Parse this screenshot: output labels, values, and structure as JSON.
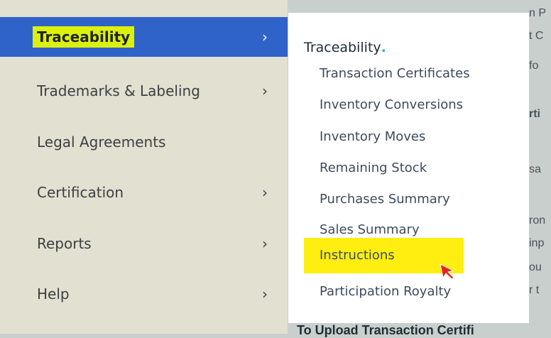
{
  "left_menu": {
    "items": [
      {
        "label": "Traceability",
        "has_submenu": true,
        "active": true
      },
      {
        "label": "Trademarks & Labeling",
        "has_submenu": true,
        "active": false
      },
      {
        "label": "Legal Agreements",
        "has_submenu": false,
        "active": false
      },
      {
        "label": "Certification",
        "has_submenu": true,
        "active": false
      },
      {
        "label": "Reports",
        "has_submenu": true,
        "active": false
      },
      {
        "label": "Help",
        "has_submenu": true,
        "active": false
      }
    ],
    "chevron": "›"
  },
  "submenu": {
    "title": "Traceability",
    "title_dot": ".",
    "items": [
      {
        "label": "Transaction Certificates"
      },
      {
        "label": "Inventory Conversions"
      },
      {
        "label": "Inventory Moves"
      },
      {
        "label": "Remaining Stock"
      },
      {
        "label": "Purchases Summary"
      },
      {
        "label": "Sales Summary"
      },
      {
        "label": "Instructions",
        "highlighted": true
      },
      {
        "label": "Participation Royalty"
      }
    ]
  },
  "background": {
    "bottom_heading": "To Upload Transaction Certifi",
    "fragments": [
      "n P",
      "t C",
      "fo",
      "rti",
      "sa",
      "ron",
      "inp",
      "ou",
      "r t"
    ]
  },
  "colors": {
    "active_bg": "#2f63c9",
    "active_label_highlight": "#dcf10a",
    "instructions_highlight": "#ffee10",
    "menu_bg": "#e2e0d1",
    "title_dot": "#22b7c9",
    "cursor": "#e8231c"
  },
  "icons": {
    "chevron": "chevron-right-icon",
    "cursor": "mouse-pointer-icon"
  }
}
